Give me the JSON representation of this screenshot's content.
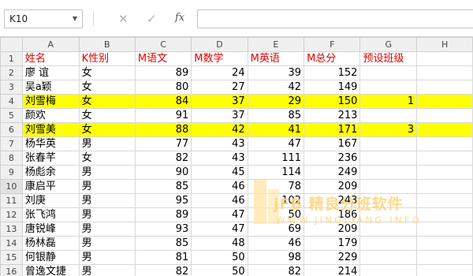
{
  "formula_bar": {
    "name_box": "K10",
    "cancel_icon": "cancel-icon",
    "confirm_icon": "confirm-icon",
    "fx_label": "fx",
    "formula": ""
  },
  "columns": [
    "A",
    "B",
    "C",
    "D",
    "E",
    "F",
    "G",
    "H"
  ],
  "header_row": {
    "row": "1",
    "cells": [
      "姓名",
      "K性别",
      "M语文",
      "M数学",
      "M英语",
      "M总分",
      "预设班级",
      ""
    ]
  },
  "rows": [
    {
      "row": "2",
      "name": "廖 谊",
      "gender": "女",
      "yuwen": "89",
      "shuxue": "24",
      "yingyu": "39",
      "zongfen": "152",
      "banji": ""
    },
    {
      "row": "3",
      "name": "吴a颖",
      "gender": "女",
      "yuwen": "80",
      "shuxue": "27",
      "yingyu": "42",
      "zongfen": "149",
      "banji": ""
    },
    {
      "row": "4",
      "name": "刘雪梅",
      "gender": "女",
      "yuwen": "84",
      "shuxue": "37",
      "yingyu": "29",
      "zongfen": "150",
      "banji": "1"
    },
    {
      "row": "5",
      "name": "颜欢",
      "gender": "女",
      "yuwen": "91",
      "shuxue": "37",
      "yingyu": "85",
      "zongfen": "213",
      "banji": ""
    },
    {
      "row": "6",
      "name": "刘雪美",
      "gender": "女",
      "yuwen": "88",
      "shuxue": "42",
      "yingyu": "41",
      "zongfen": "171",
      "banji": "3"
    },
    {
      "row": "7",
      "name": "杨华英",
      "gender": "男",
      "yuwen": "77",
      "shuxue": "43",
      "yingyu": "47",
      "zongfen": "167",
      "banji": ""
    },
    {
      "row": "8",
      "name": "张春芊",
      "gender": "女",
      "yuwen": "82",
      "shuxue": "43",
      "yingyu": "111",
      "zongfen": "236",
      "banji": ""
    },
    {
      "row": "9",
      "name": "杨彪余",
      "gender": "男",
      "yuwen": "90",
      "shuxue": "45",
      "yingyu": "114",
      "zongfen": "249",
      "banji": ""
    },
    {
      "row": "10",
      "name": "康启平",
      "gender": "男",
      "yuwen": "85",
      "shuxue": "46",
      "yingyu": "78",
      "zongfen": "209",
      "banji": ""
    },
    {
      "row": "11",
      "name": "刘庚",
      "gender": "男",
      "yuwen": "95",
      "shuxue": "46",
      "yingyu": "102",
      "zongfen": "243",
      "banji": ""
    },
    {
      "row": "12",
      "name": "张飞鸿",
      "gender": "男",
      "yuwen": "89",
      "shuxue": "47",
      "yingyu": "50",
      "zongfen": "186",
      "banji": ""
    },
    {
      "row": "13",
      "name": "唐锐峰",
      "gender": "男",
      "yuwen": "93",
      "shuxue": "47",
      "yingyu": "69",
      "zongfen": "209",
      "banji": ""
    },
    {
      "row": "14",
      "name": "杨林磊",
      "gender": "男",
      "yuwen": "85",
      "shuxue": "48",
      "yingyu": "46",
      "zongfen": "179",
      "banji": ""
    },
    {
      "row": "15",
      "name": "何银静",
      "gender": "男",
      "yuwen": "81",
      "shuxue": "50",
      "yingyu": "98",
      "zongfen": "229",
      "banji": ""
    },
    {
      "row": "16",
      "name": "曾逸文捷",
      "gender": "男",
      "yuwen": "82",
      "shuxue": "50",
      "yingyu": "82",
      "zongfen": "214",
      "banji": ""
    }
  ],
  "highlight_rows": [
    "4",
    "6"
  ],
  "colors": {
    "highlight": "#ffff00",
    "header_text": "#e00000",
    "watermark": "#ffd37a"
  },
  "watermark": {
    "title": "jFB 精良分班软件",
    "url": "WWW.JINGLIANG.INFO"
  }
}
